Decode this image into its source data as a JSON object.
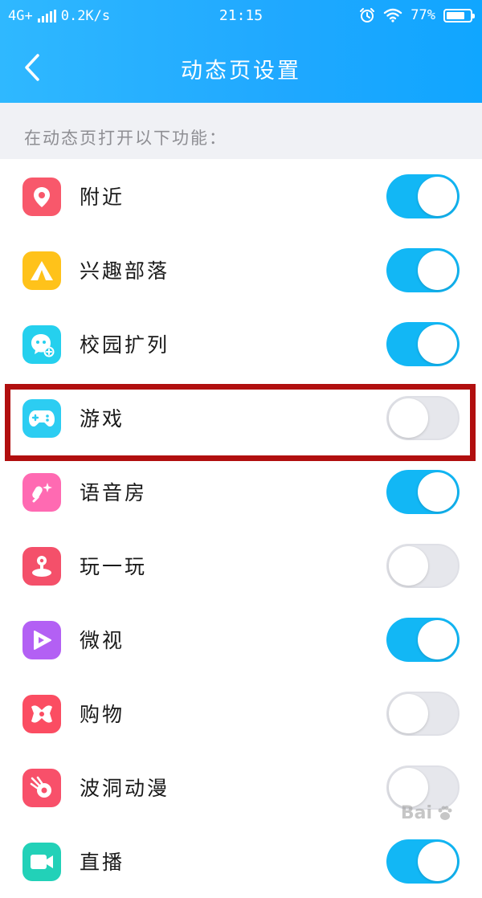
{
  "status_bar": {
    "network": "4G+",
    "speed": "0.2K/s",
    "time": "21:15",
    "battery": "77%",
    "battery_level": 0.77
  },
  "nav": {
    "title": "动态页设置"
  },
  "section": {
    "header": "在动态页打开以下功能："
  },
  "items": [
    {
      "label": "附近",
      "enabled": true,
      "icon": "location-pin-icon",
      "color": "#f8586b"
    },
    {
      "label": "兴趣部落",
      "enabled": true,
      "icon": "tent-icon",
      "color": "#ffc21a"
    },
    {
      "label": "校园扩列",
      "enabled": true,
      "icon": "chat-bubble-plus-icon",
      "color": "#25d0ee"
    },
    {
      "label": "游戏",
      "enabled": false,
      "icon": "gamepad-icon",
      "color": "#2ccdf2"
    },
    {
      "label": "语音房",
      "enabled": true,
      "icon": "microphone-sparkle-icon",
      "color": "#ff6ab2"
    },
    {
      "label": "玩一玩",
      "enabled": false,
      "icon": "joystick-icon",
      "color": "#f4506a"
    },
    {
      "label": "微视",
      "enabled": true,
      "icon": "play-icon",
      "color": "#b360f4"
    },
    {
      "label": "购物",
      "enabled": false,
      "icon": "ribbon-bag-icon",
      "color": "#fb4d62"
    },
    {
      "label": "波洞动漫",
      "enabled": false,
      "icon": "comet-icon",
      "color": "#f8506a"
    },
    {
      "label": "直播",
      "enabled": true,
      "icon": "video-icon",
      "color": "#22d1b8"
    }
  ],
  "colors": {
    "accent": "#12b7f5",
    "toggle_off": "#e6e7ec",
    "highlight": "#b10f0f"
  }
}
